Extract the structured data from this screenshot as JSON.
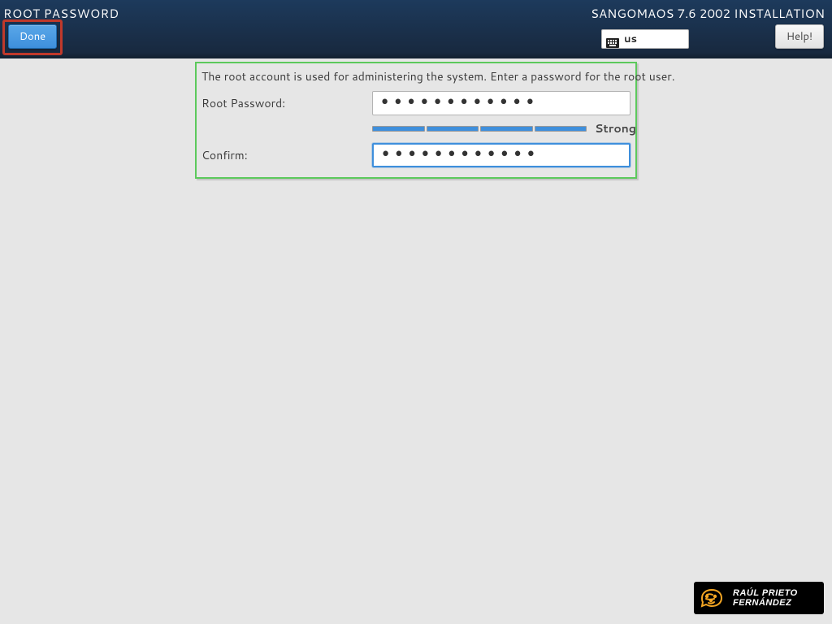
{
  "header": {
    "page_title": "ROOT PASSWORD",
    "installer_title": "SANGOMAOS 7.6 2002 INSTALLATION",
    "done_label": "Done",
    "help_label": "Help!",
    "keyboard_layout": "us"
  },
  "form": {
    "instruction": "The root account is used for administering the system.  Enter a password for the root user.",
    "root_password_label": "Root Password:",
    "root_password_value": "••••••••••••",
    "confirm_label": "Confirm:",
    "confirm_value": "••••••••••••",
    "strength_label": "Strong"
  },
  "watermark": {
    "line1": "RAÚL PRIETO",
    "line2": "FERNÁNDEZ"
  }
}
